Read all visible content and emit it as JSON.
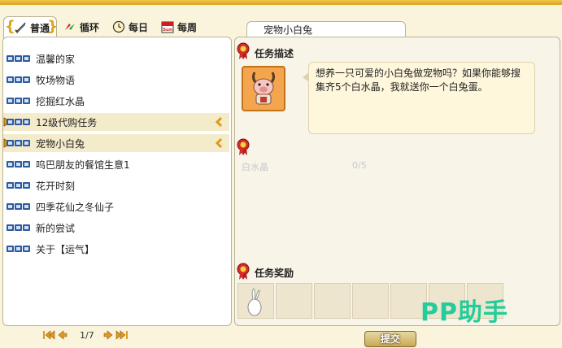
{
  "tabs": [
    {
      "label": "普通",
      "icon": "sword-icon"
    },
    {
      "label": "循环",
      "icon": "cycle-icon"
    },
    {
      "label": "每日",
      "icon": "clock-icon"
    },
    {
      "label": "每周",
      "icon": "calendar-icon"
    }
  ],
  "calendar_icon_text": "Sun",
  "quests": [
    {
      "label": "温馨的家"
    },
    {
      "label": "牧场物语"
    },
    {
      "label": "挖掘红水晶"
    },
    {
      "label": "12级代购任务"
    },
    {
      "label": "宠物小白兔"
    },
    {
      "label": "呜巴朋友的餐馆生意1"
    },
    {
      "label": "花开时刻"
    },
    {
      "label": "四季花仙之冬仙子"
    },
    {
      "label": "新的尝试"
    },
    {
      "label": "关于【运气】"
    }
  ],
  "selected_indices": [
    3,
    4
  ],
  "pager": {
    "page_text": "1/7"
  },
  "detail": {
    "tab_title": "宠物小白兔",
    "description_title": "任务描述",
    "description_text": "想养一只可爱的小白兔做宠物吗？如果你能够搜集齐5个白水晶，我就送你一个白兔蛋。",
    "requirement": {
      "item": "白水晶",
      "count": "0/5"
    },
    "reward_title": "任务奖励",
    "reward_slots": 7,
    "reward_item_icon": "bunny-egg-icon"
  },
  "watermark": "PP助手",
  "submit_label": "提交",
  "colors": {
    "accent": "#e0a21a",
    "panel_border": "#b9b497",
    "selected_row": "#f4ebcb",
    "watermark": "#21cd9a"
  }
}
